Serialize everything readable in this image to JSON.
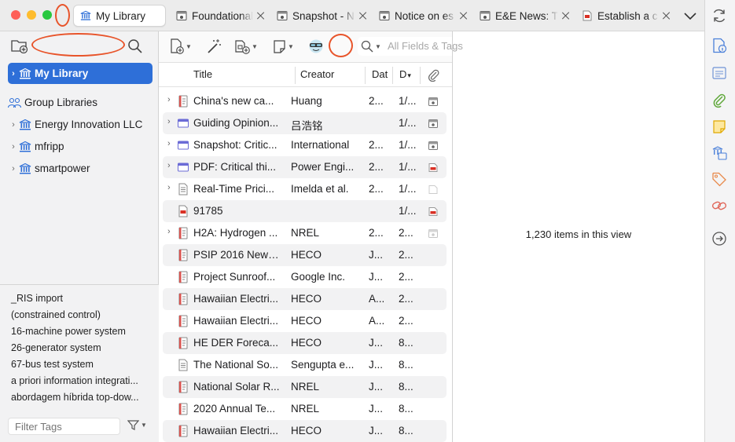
{
  "tabs": [
    {
      "label": "My Library",
      "icon": "library-icon"
    },
    {
      "label": "Foundational",
      "icon": "snapshot-icon"
    },
    {
      "label": "Snapshot - N",
      "icon": "snapshot-icon"
    },
    {
      "label": "Notice on es",
      "icon": "snapshot-icon"
    },
    {
      "label": "E&E News: T",
      "icon": "snapshot-icon"
    },
    {
      "label": "Establish a c",
      "icon": "pdf-icon"
    }
  ],
  "collections": {
    "my_library": "My Library",
    "group_libraries": "Group Libraries",
    "groups": [
      "Energy Innovation LLC",
      "mfripp",
      "smartpower"
    ]
  },
  "tags": [
    "_RIS import",
    "(constrained control)",
    "16-machine power system",
    "26-generator system",
    "67-bus test system",
    "a priori information integrati...",
    "abordagem híbrida top-dow..."
  ],
  "filter_tags_placeholder": "Filter Tags",
  "search_placeholder": "All Fields & Tags",
  "columns": {
    "title": "Title",
    "creator": "Creator",
    "date": "Dat",
    "date_added": "D"
  },
  "items": [
    {
      "title": "China's new ca...",
      "creator": "Huang",
      "date": "2...",
      "added": "1/...",
      "type": "report",
      "attach": "snapshot",
      "expand": true
    },
    {
      "title": "Guiding Opinion...",
      "creator": "吕浩铭",
      "date": "",
      "added": "1/...",
      "type": "webpage",
      "attach": "snapshot",
      "expand": true
    },
    {
      "title": "Snapshot: Critic...",
      "creator": "International",
      "date": "2...",
      "added": "1/...",
      "type": "webpage",
      "attach": "snapshot",
      "expand": true
    },
    {
      "title": "PDF: Critical thi...",
      "creator": "Power Engi...",
      "date": "2...",
      "added": "1/...",
      "type": "webpage",
      "attach": "pdf",
      "expand": true
    },
    {
      "title": "Real-Time Prici...",
      "creator": "Imelda et al.",
      "date": "2...",
      "added": "1/...",
      "type": "document",
      "attach": "file",
      "expand": true
    },
    {
      "title": "91785",
      "creator": "",
      "date": "",
      "added": "1/...",
      "type": "pdf",
      "attach": "pdf",
      "expand": false
    },
    {
      "title": "H2A: Hydrogen ...",
      "creator": "NREL",
      "date": "2...",
      "added": "2...",
      "type": "report",
      "attach": "snapshot-faded",
      "expand": true
    },
    {
      "title": "PSIP 2016 New ...",
      "creator": "HECO",
      "date": "J...",
      "added": "2...",
      "type": "report",
      "attach": "",
      "expand": false
    },
    {
      "title": "Project Sunroof...",
      "creator": "Google Inc.",
      "date": "J...",
      "added": "2...",
      "type": "report",
      "attach": "",
      "expand": false
    },
    {
      "title": "Hawaiian Electri...",
      "creator": "HECO",
      "date": "A...",
      "added": "2...",
      "type": "report",
      "attach": "",
      "expand": false
    },
    {
      "title": "Hawaiian Electri...",
      "creator": "HECO",
      "date": "A...",
      "added": "2...",
      "type": "report",
      "attach": "",
      "expand": false
    },
    {
      "title": "HE DER Foreca...",
      "creator": "HECO",
      "date": "J...",
      "added": "8...",
      "type": "report",
      "attach": "",
      "expand": false
    },
    {
      "title": "The National So...",
      "creator": "Sengupta e...",
      "date": "J...",
      "added": "8...",
      "type": "document",
      "attach": "",
      "expand": false
    },
    {
      "title": "National Solar R...",
      "creator": "NREL",
      "date": "J...",
      "added": "8...",
      "type": "report",
      "attach": "",
      "expand": false
    },
    {
      "title": "2020 Annual Te...",
      "creator": "NREL",
      "date": "J...",
      "added": "8...",
      "type": "report",
      "attach": "",
      "expand": false
    },
    {
      "title": "Hawaiian Electri...",
      "creator": "HECO",
      "date": "J...",
      "added": "8...",
      "type": "report",
      "attach": "",
      "expand": false
    }
  ],
  "items_count": "1,230 items in this view",
  "colors": {
    "selection": "#2e6fd8",
    "annotation": "#e8542a",
    "library_icon": "#2e6fd8"
  }
}
